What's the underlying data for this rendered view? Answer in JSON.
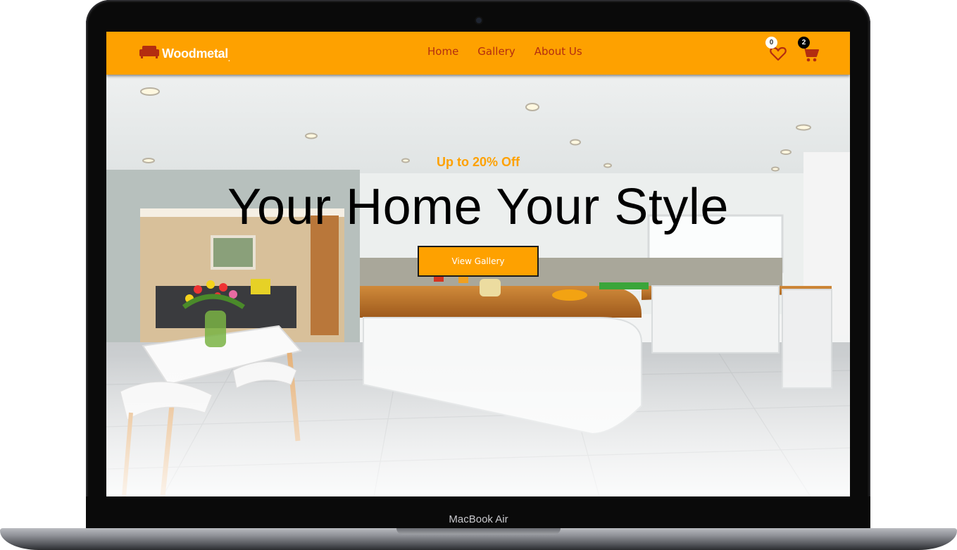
{
  "device": {
    "model_label": "MacBook Air"
  },
  "header": {
    "brand": "Woodmetal",
    "brand_suffix": ".",
    "logo_icon": "sofa-icon",
    "nav": [
      {
        "label": "Home"
      },
      {
        "label": "Gallery"
      },
      {
        "label": "About Us"
      }
    ],
    "wishlist": {
      "icon": "heart-icon",
      "count": "0"
    },
    "cart": {
      "icon": "cart-icon",
      "count": "2"
    }
  },
  "hero": {
    "offer": "Up to 20% Off",
    "headline": "Your Home Your Style",
    "cta_label": "View Gallery",
    "background_image": "kitchen-interior-photo"
  },
  "colors": {
    "accent": "#fea100",
    "nav_link": "#b32d10",
    "headline": "#000000",
    "badge_dark": "#000000"
  }
}
